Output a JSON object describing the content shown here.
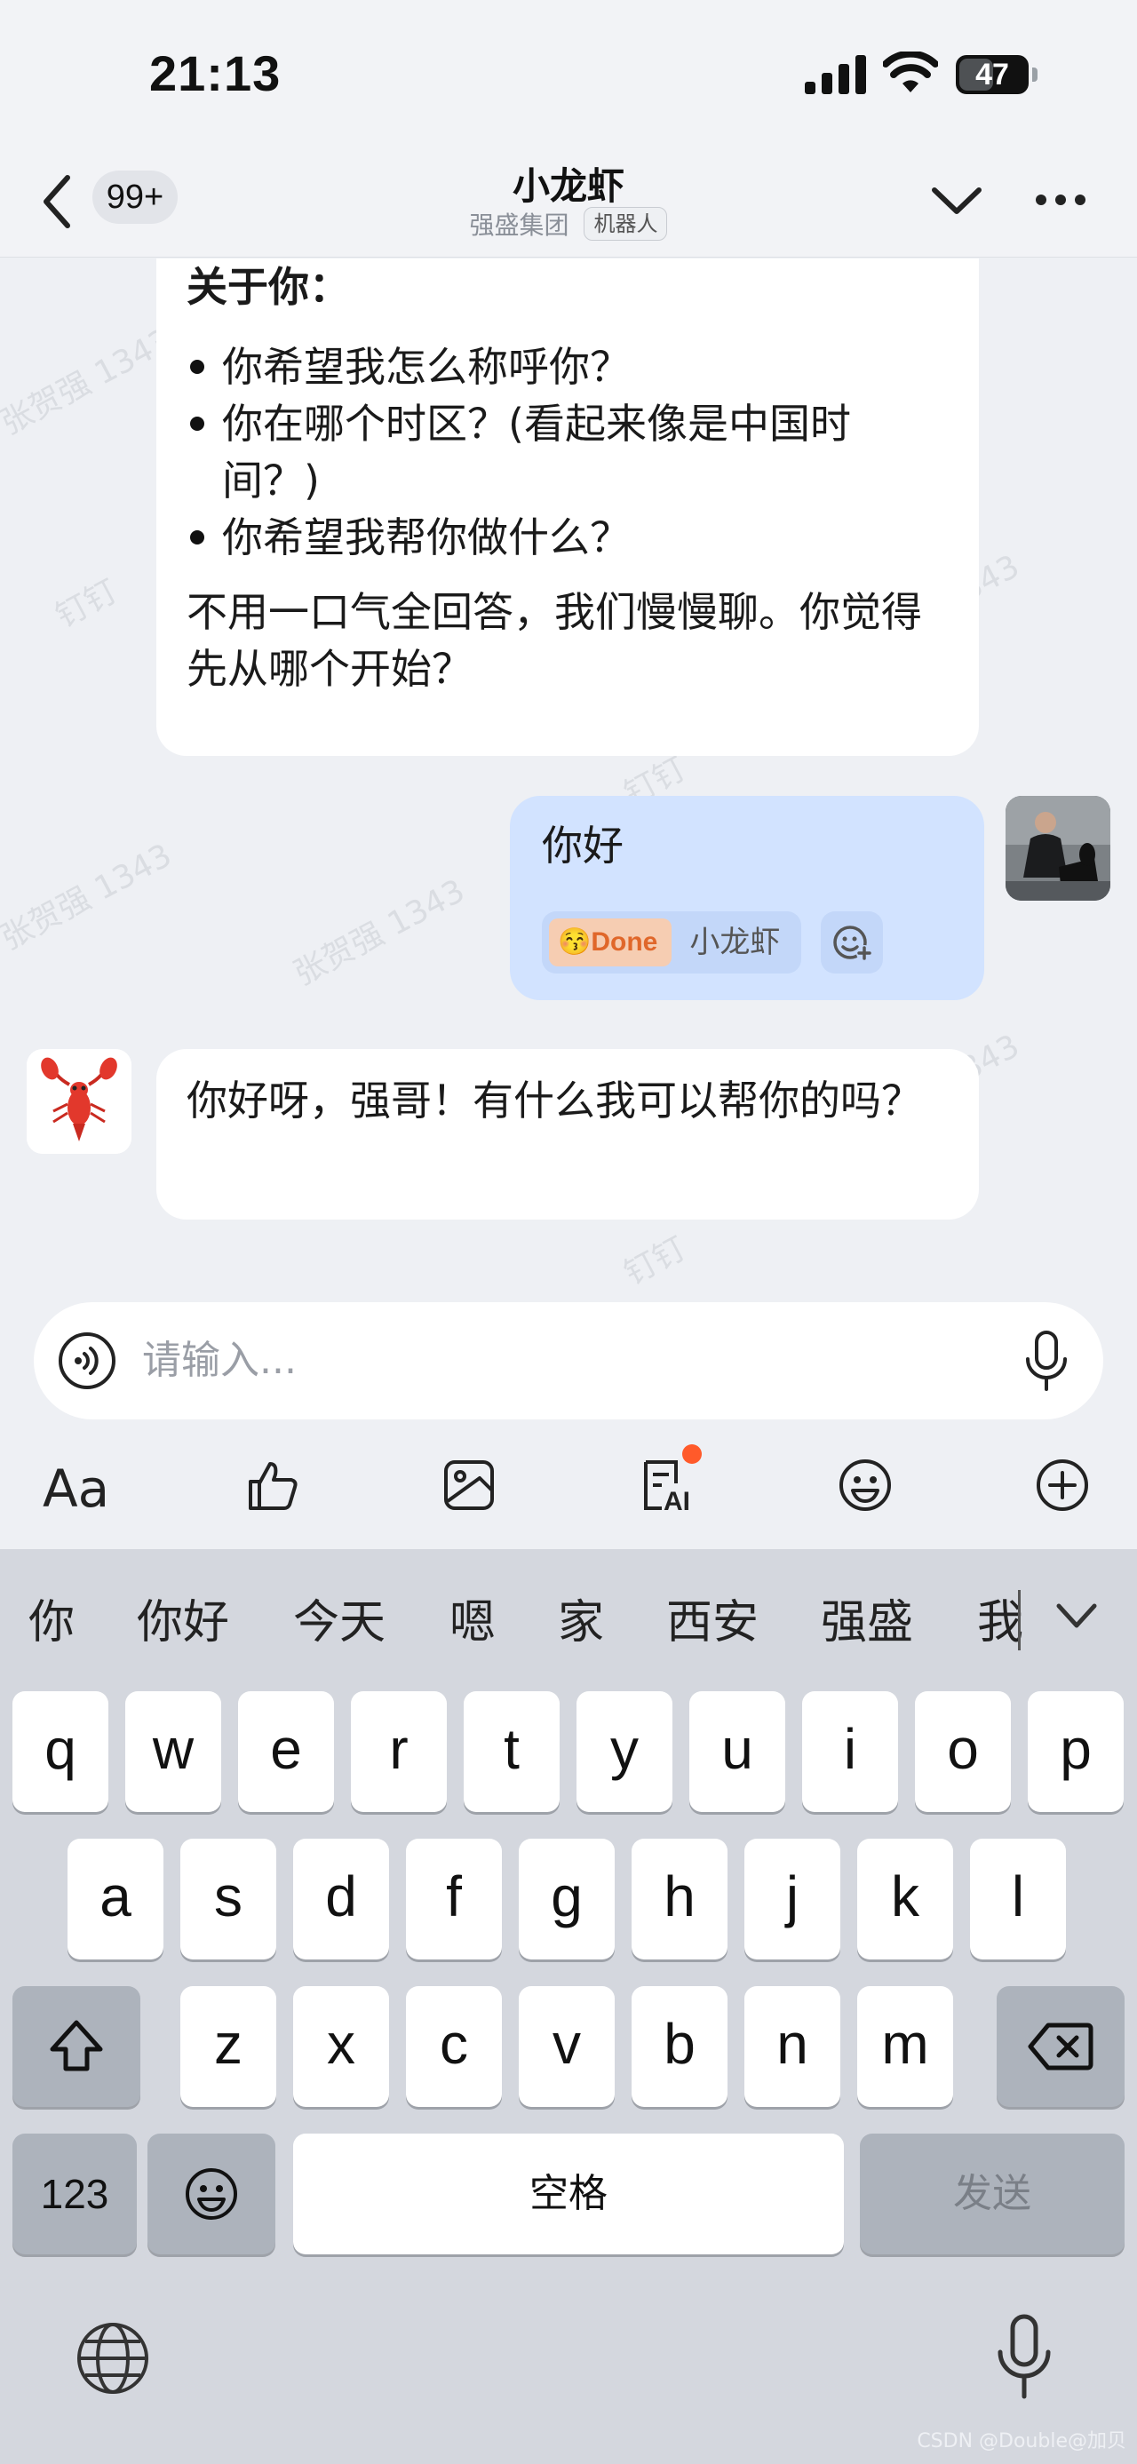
{
  "status_bar": {
    "time": "21:13",
    "battery": "47"
  },
  "header": {
    "unread_count": "99+",
    "title": "小龙虾",
    "subtitle_org": "强盛集团",
    "subtitle_tag": "机器人"
  },
  "watermark": {
    "name_text": "张贺强 1343",
    "app_text": "钉钉",
    "partial_number": "343"
  },
  "messages": [
    {
      "sender": "bot",
      "heading": "关于你：",
      "bullets": [
        "你希望我怎么称呼你？",
        "你在哪个时区？(看起来像是中国时间？)",
        "你希望我帮你做什么？"
      ],
      "text": "不用一口气全回答，我们慢慢聊。你觉得先从哪个开始？"
    },
    {
      "sender": "me",
      "text": "你好",
      "reaction": {
        "emoji": "😚",
        "label": "Done",
        "by": "小龙虾"
      }
    },
    {
      "sender": "bot",
      "text": "你好呀，强哥！有什么我可以帮你的吗？"
    }
  ],
  "input": {
    "placeholder": "请输入..."
  },
  "toolbar": {
    "items": [
      "text-format-icon",
      "thumbs-up-icon",
      "image-icon",
      "ai-doc-icon",
      "emoji-icon",
      "plus-icon"
    ],
    "accent_dot_color": "#ff5a2a",
    "font_label": "Aa",
    "ai_label": "AI"
  },
  "keyboard": {
    "candidates": [
      "你",
      "你好",
      "今天",
      "嗯",
      "家",
      "西安",
      "强盛",
      "我"
    ],
    "row1": [
      "q",
      "w",
      "e",
      "r",
      "t",
      "y",
      "u",
      "i",
      "o",
      "p"
    ],
    "row2": [
      "a",
      "s",
      "d",
      "f",
      "g",
      "h",
      "j",
      "k",
      "l"
    ],
    "row3": [
      "z",
      "x",
      "c",
      "v",
      "b",
      "n",
      "m"
    ],
    "numbers_key": "123",
    "space_key": "空格",
    "send_key": "发送"
  },
  "credit": "CSDN @Double@加贝"
}
